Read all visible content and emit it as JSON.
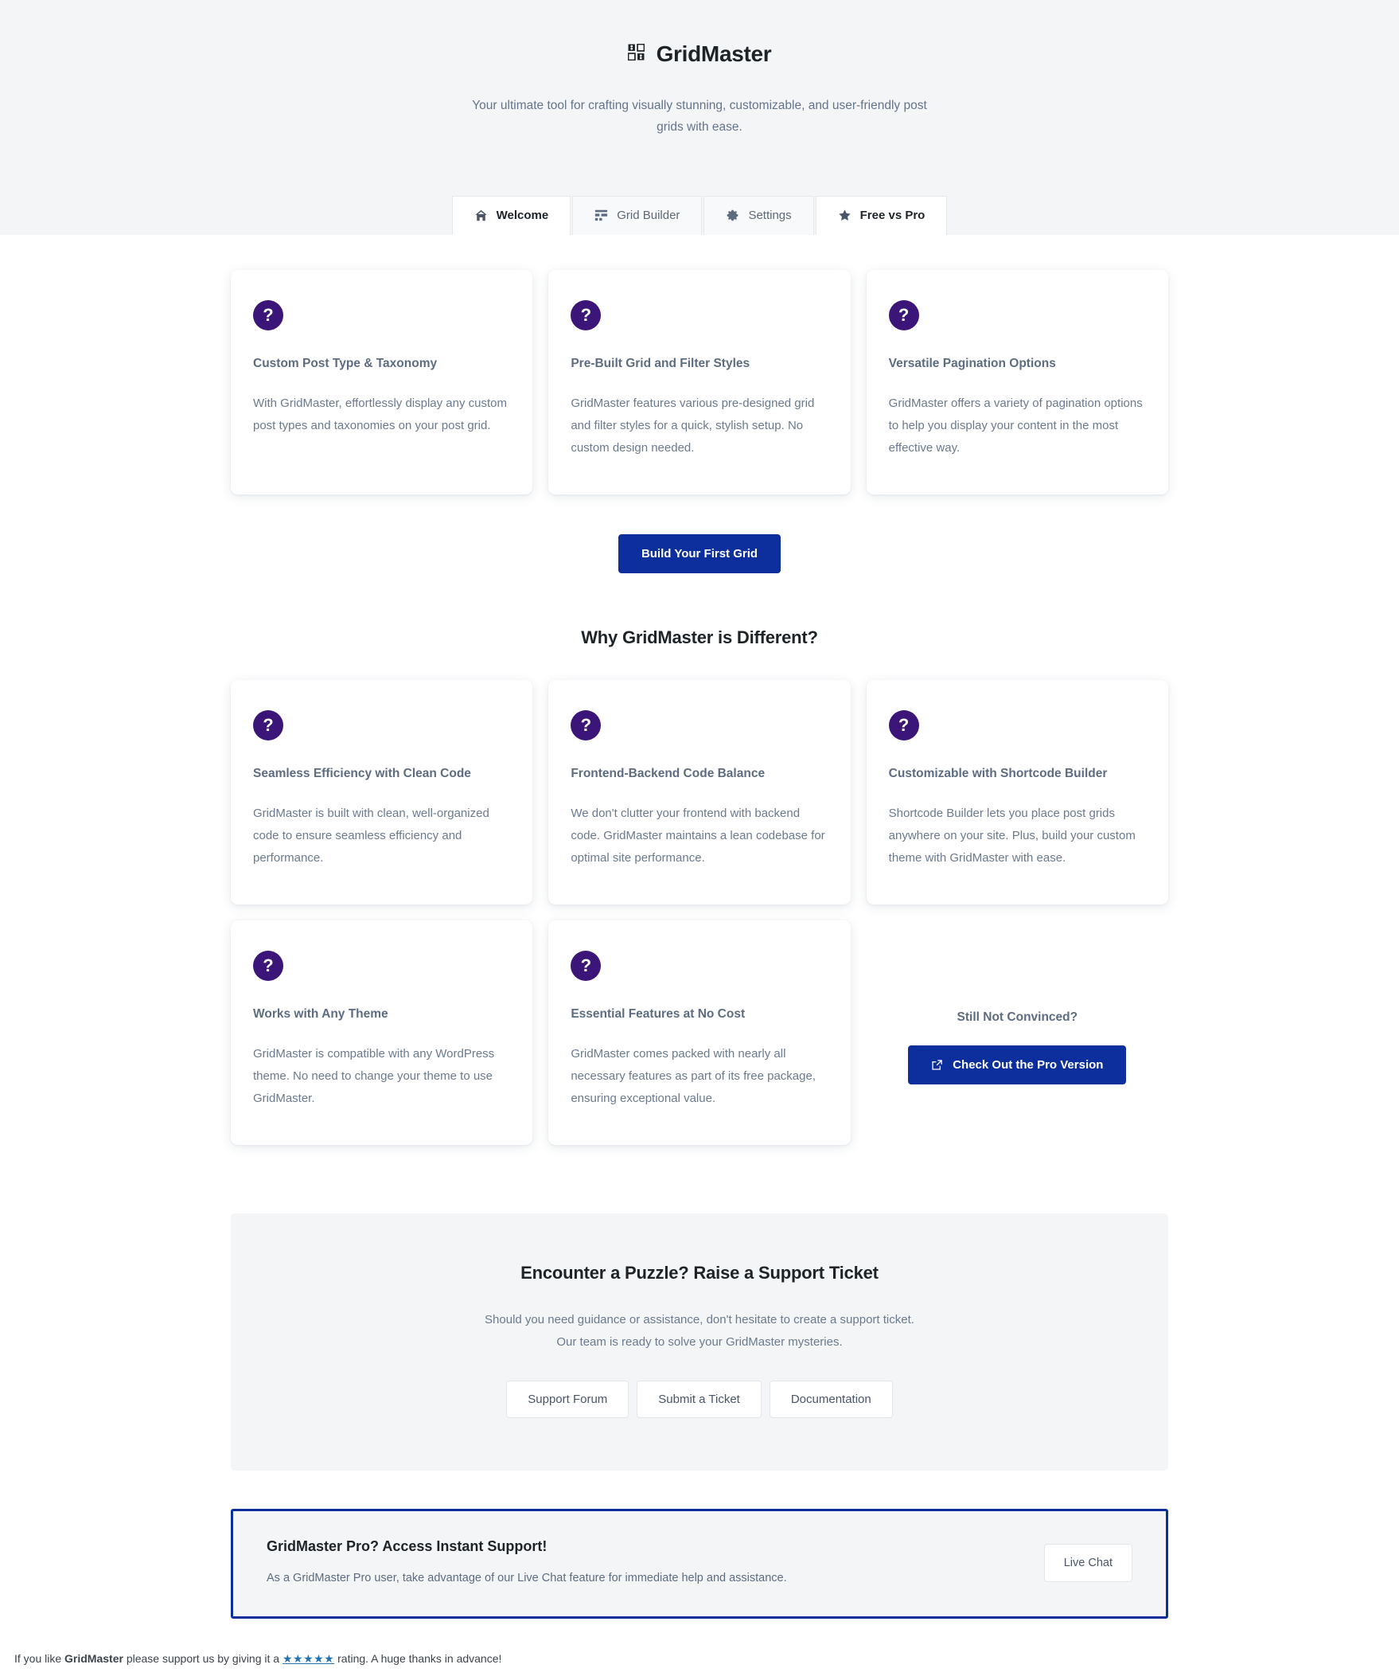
{
  "header": {
    "logo_icon": "grid-2x2-icon",
    "title": "GridMaster",
    "tagline": "Your ultimate tool for crafting visually stunning, customizable, and user-friendly post grids with ease."
  },
  "tabs": [
    {
      "label": "Welcome",
      "icon": "home-icon",
      "active": true
    },
    {
      "label": "Grid Builder",
      "icon": "layout-icon",
      "active": false
    },
    {
      "label": "Settings",
      "icon": "gear-icon",
      "active": false
    },
    {
      "label": "Free vs Pro",
      "icon": "star-icon",
      "active": true
    }
  ],
  "features_top": [
    {
      "icon": "question-mark-icon",
      "title": "Custom Post Type & Taxonomy",
      "text": "With GridMaster, effortlessly display any custom post types and taxonomies on your post grid."
    },
    {
      "icon": "question-mark-icon",
      "title": "Pre-Built Grid and Filter Styles",
      "text": "GridMaster features various pre-designed grid and filter styles for a quick, stylish setup. No custom design needed."
    },
    {
      "icon": "question-mark-icon",
      "title": "Versatile Pagination Options",
      "text": "GridMaster offers a variety of pagination options to help you display your content in the most effective way."
    }
  ],
  "cta": {
    "build_grid_label": "Build Your First Grid"
  },
  "why_section": {
    "heading": "Why GridMaster is Different?"
  },
  "features_why": [
    {
      "icon": "question-mark-icon",
      "title": "Seamless Efficiency with Clean Code",
      "text": "GridMaster is built with clean, well-organized code to ensure seamless efficiency and performance."
    },
    {
      "icon": "question-mark-icon",
      "title": "Frontend-Backend Code Balance",
      "text": "We don't clutter your frontend with backend code. GridMaster maintains a lean codebase for optimal site performance."
    },
    {
      "icon": "question-mark-icon",
      "title": "Customizable with Shortcode Builder",
      "text": "Shortcode Builder lets you place post grids anywhere on your site. Plus, build your custom theme with GridMaster with ease."
    },
    {
      "icon": "question-mark-icon",
      "title": "Works with Any Theme",
      "text": "GridMaster is compatible with any WordPress theme. No need to change your theme to use GridMaster."
    },
    {
      "icon": "question-mark-icon",
      "title": "Essential Features at No Cost",
      "text": "GridMaster comes packed with nearly all necessary features as part of its free package, ensuring exceptional value."
    }
  ],
  "convince": {
    "title": "Still Not Convinced?",
    "button_label": "Check Out the Pro Version",
    "button_icon": "external-link-icon"
  },
  "support": {
    "title": "Encounter a Puzzle? Raise a Support Ticket",
    "line1": "Should you need guidance or assistance, don't hesitate to create a support ticket.",
    "line2": "Our team is ready to solve your GridMaster mysteries.",
    "buttons": [
      "Support Forum",
      "Submit a Ticket",
      "Documentation"
    ]
  },
  "pro_banner": {
    "title": "GridMaster Pro? Access Instant Support!",
    "text": "As a GridMaster Pro user, take advantage of our Live Chat feature for immediate help and assistance.",
    "button_label": "Live Chat"
  },
  "footer": {
    "text_before": "If you like ",
    "brand": "GridMaster",
    "text_mid": " please support us by giving it a ",
    "stars": "★★★★★",
    "text_after": " rating. A huge thanks in advance!"
  },
  "colors": {
    "accent_blue": "#0d2f9e",
    "icon_purple": "#3b1578",
    "band_grey": "#f4f5f7",
    "muted_text": "#6b7a8d",
    "link_blue": "#2271b1"
  }
}
